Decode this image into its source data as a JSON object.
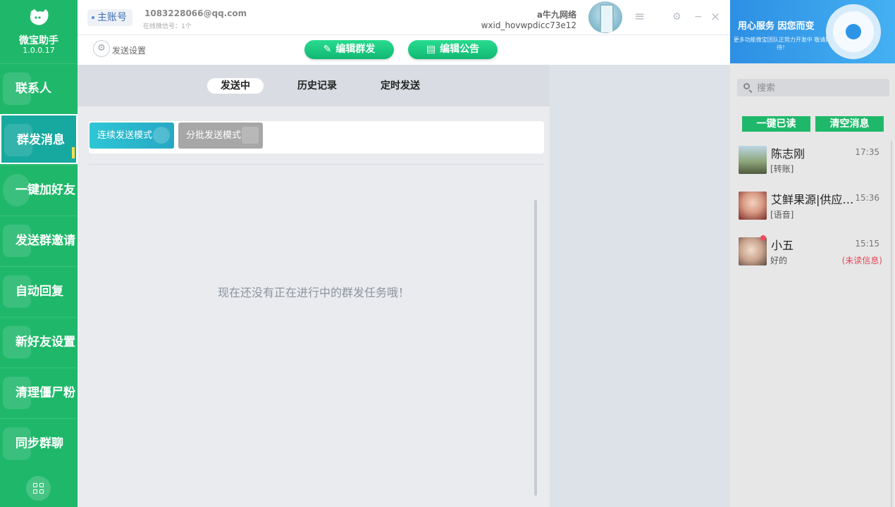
{
  "brand": {
    "name": "微宝助手",
    "version": "1.0.0.17"
  },
  "sidebar": {
    "items": [
      {
        "label": "联系人"
      },
      {
        "label": "群发消息"
      },
      {
        "label": "一键加好友"
      },
      {
        "label": "发送群邀请"
      },
      {
        "label": "自动回复"
      },
      {
        "label": "新好友设置"
      },
      {
        "label": "清理僵尸粉"
      },
      {
        "label": "同步群聊"
      }
    ],
    "active_index": 1
  },
  "topbar": {
    "account_tab": "主账号",
    "email": "1083228066@qq.com",
    "online_count": "在线微信号：1个",
    "nickname": "a牛九网络",
    "wxid": "wxid_hovwpdicc73e12",
    "menu_glyph": "≡",
    "settings_glyph": "⚙",
    "minimize_glyph": "−",
    "close_glyph": "×"
  },
  "subbar": {
    "send_settings": "发送设置",
    "edit_mass": "编辑群发",
    "edit_notice": "编辑公告"
  },
  "tabs": [
    {
      "label": "发送中",
      "active": true
    },
    {
      "label": "历史记录",
      "active": false
    },
    {
      "label": "定时发送",
      "active": false
    }
  ],
  "modes": {
    "continuous": "连续发送模式",
    "batch": "分批发送模式"
  },
  "empty_message": "现在还没有正在进行中的群发任务哦！",
  "promo": {
    "title": "用心服务 因您而变",
    "subtitle": "更多功能微宝团队正努力开发中 敬请期待！"
  },
  "right_panel": {
    "search_placeholder": "搜索",
    "mark_read": "一键已读",
    "clear_messages": "清空消息",
    "chats": [
      {
        "name": "陈志刚",
        "time": "17:35",
        "message": "[转账]",
        "status": ""
      },
      {
        "name": "艾鲜果源|供应链…",
        "time": "15:36",
        "message": "[语音]",
        "status": ""
      },
      {
        "name": "小五",
        "time": "15:15",
        "message": "好的",
        "status": "(未读信息)"
      }
    ]
  },
  "colors": {
    "sidebar": "#1fb86a",
    "active_nav": "#17a9a0",
    "accent_green": "#1fb86a",
    "unread_red": "#e0475a"
  }
}
